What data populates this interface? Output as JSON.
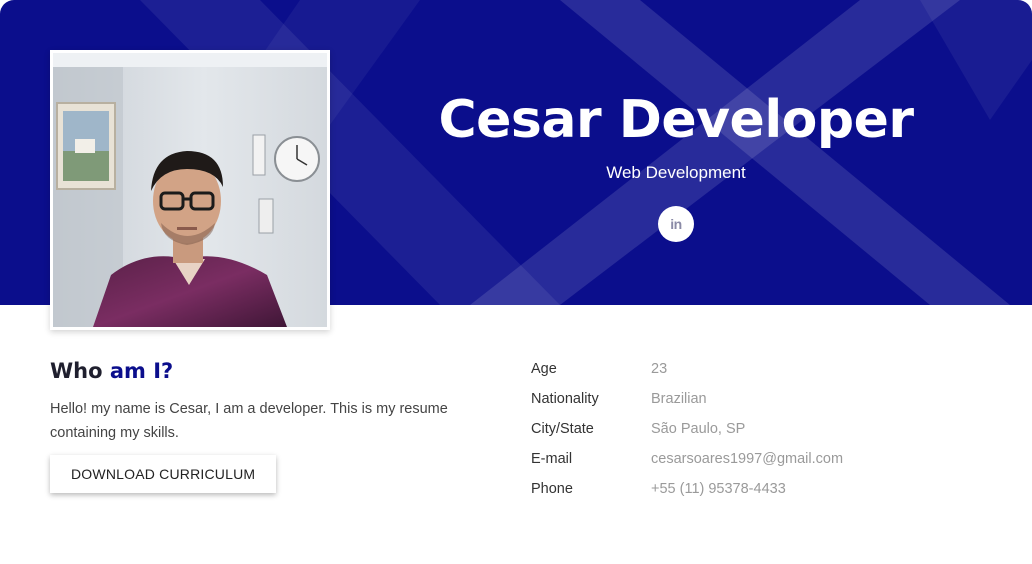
{
  "profile": {
    "name": "Cesar Developer",
    "role": "Web Development",
    "social_icon": "linkedin-icon",
    "social_glyph": "in"
  },
  "about": {
    "title_start": "Who",
    "title_accent": "am I?",
    "description": "Hello! my name is Cesar, I am a developer. This is my resume containing my skills.",
    "button_label": "DOWNLOAD CURRICULUM"
  },
  "info": [
    {
      "label": "Age",
      "value": "23"
    },
    {
      "label": "Nationality",
      "value": "Brazilian"
    },
    {
      "label": "City/State",
      "value": "São Paulo, SP"
    },
    {
      "label": "E-mail",
      "value": "cesarsoares1997@gmail.com"
    },
    {
      "label": "Phone",
      "value": "+55 (11) 95378-4433"
    }
  ],
  "colors": {
    "hero_bg": "#0b0e8c",
    "accent": "#0b0e8c",
    "text_dark": "#1f1f2e",
    "text_muted": "#9a9a9a"
  }
}
